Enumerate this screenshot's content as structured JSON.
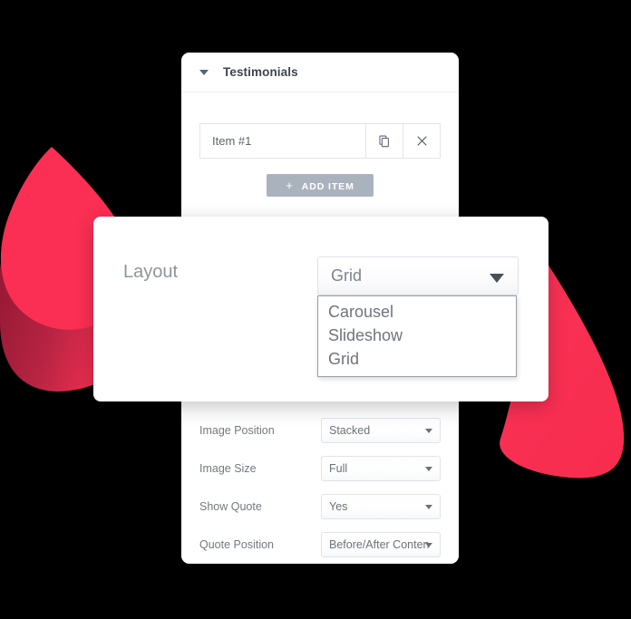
{
  "panel": {
    "title": "Testimonials",
    "collapse_icon": "caret-down-icon",
    "repeater": {
      "item_label": "Item #1",
      "duplicate_icon": "copy-icon",
      "remove_icon": "close-x-icon",
      "add_button": {
        "plus": "+",
        "label": "ADD ITEM"
      }
    },
    "fields": [
      {
        "label": "Image Position",
        "value": "Stacked",
        "arrow_icon": "chevron-down-icon"
      },
      {
        "label": "Image Size",
        "value": "Full",
        "arrow_icon": "chevron-down-icon"
      },
      {
        "label": "Show Quote",
        "value": "Yes",
        "arrow_icon": "chevron-down-icon"
      },
      {
        "label": "Quote Position",
        "value": "Before/After Conten",
        "arrow_icon": "chevron-down-icon"
      }
    ]
  },
  "overlay": {
    "layout_label": "Layout",
    "layout_value": "Grid",
    "layout_arrow_icon": "caret-down-icon",
    "options": [
      {
        "label": "Carousel",
        "selected": false
      },
      {
        "label": "Slideshow",
        "selected": false
      },
      {
        "label": "Grid",
        "selected": true
      }
    ]
  },
  "colors": {
    "background": "#000000",
    "accent_pink": "#fa2f53",
    "accent_pink_dark": "#a01b37",
    "panel_surface": "#ffffff",
    "button_gray": "#aab3bd",
    "text_gray": "#6f757c"
  }
}
